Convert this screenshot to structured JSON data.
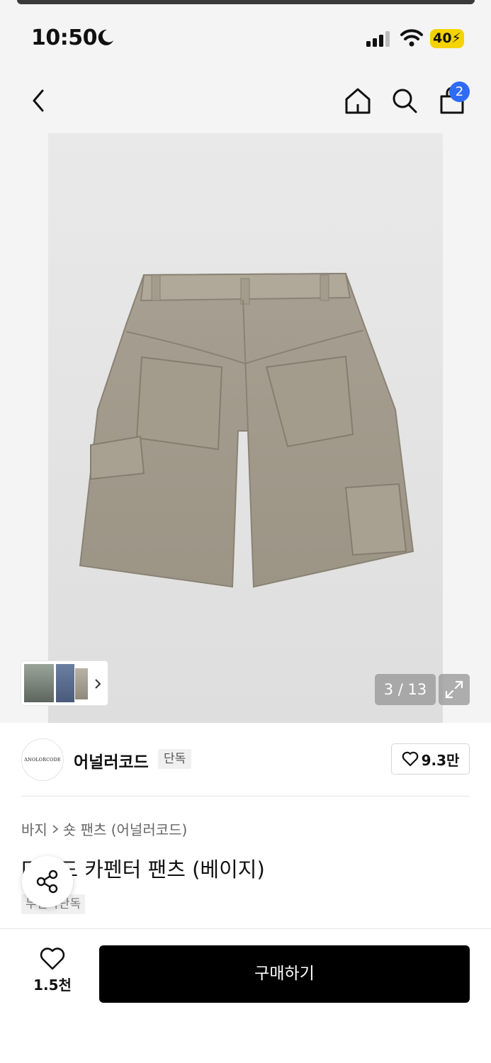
{
  "status_bar": {
    "time": "10:50",
    "battery": "40"
  },
  "header": {
    "cart_count": "2"
  },
  "gallery": {
    "counter": "3 / 13"
  },
  "brand": {
    "logo_text": "ANOLORCODE",
    "name": "어널러코드",
    "tag": "단독",
    "favorites": "9.3만"
  },
  "product": {
    "breadcrumb": [
      "바지",
      "숏 팬츠 (어널러코드)"
    ],
    "title": "다잉드 카펜터 팬츠 (베이지)",
    "tag": "무신사단독"
  },
  "bottom": {
    "likes": "1.5천",
    "buy_label": "구매하기"
  },
  "colors": {
    "accent_blue": "#2f6cf6",
    "buy_bg": "#000000",
    "battery": "#f5d300"
  }
}
